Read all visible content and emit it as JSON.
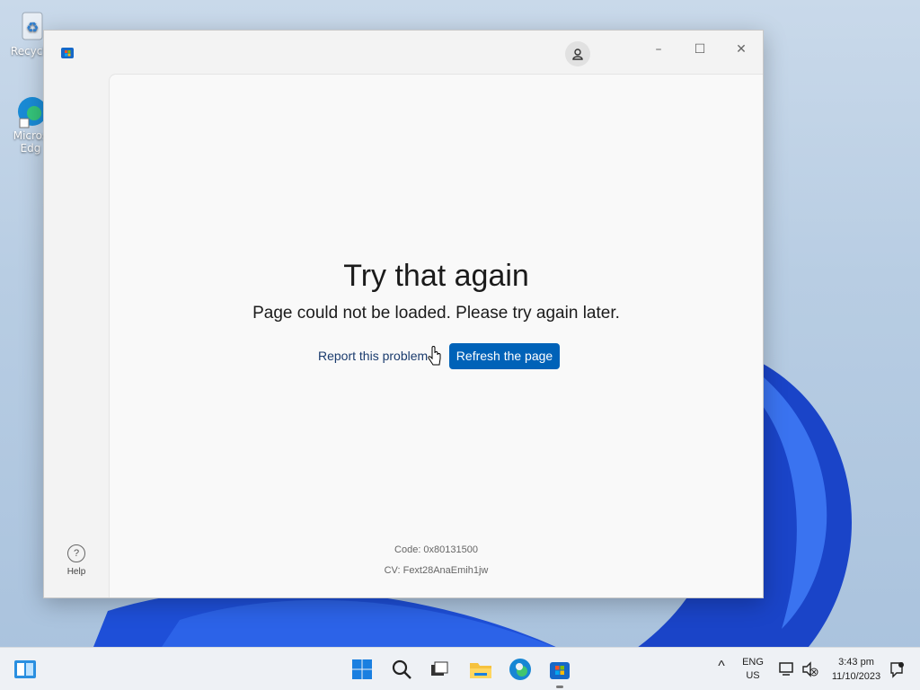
{
  "desktop": {
    "icons": [
      {
        "label": "Recycle",
        "icon": "recycle-bin-icon"
      },
      {
        "label": "Micros\nEdg",
        "icon": "edge-icon"
      }
    ]
  },
  "window": {
    "app_icon": "store-icon",
    "account_icon": "user-icon",
    "controls": {
      "minimize": "–",
      "maximize": "☐",
      "close": "✕"
    },
    "error": {
      "title": "Try that again",
      "message": "Page could not be loaded. Please try again later.",
      "report_label": "Report this problem",
      "refresh_label": "Refresh the page",
      "code": "Code: 0x80131500",
      "cv": "CV: Fext28AnaEmih1jw"
    },
    "help_label": "Help"
  },
  "taskbar": {
    "items": [
      "widgets-icon",
      "start-icon",
      "search-icon",
      "task-view-icon",
      "file-explorer-icon",
      "edge-icon",
      "store-icon"
    ],
    "tray": {
      "chevron": "^",
      "language": "ENG",
      "region": "US",
      "time": "3:43 pm",
      "date": "11/10/2023"
    }
  }
}
